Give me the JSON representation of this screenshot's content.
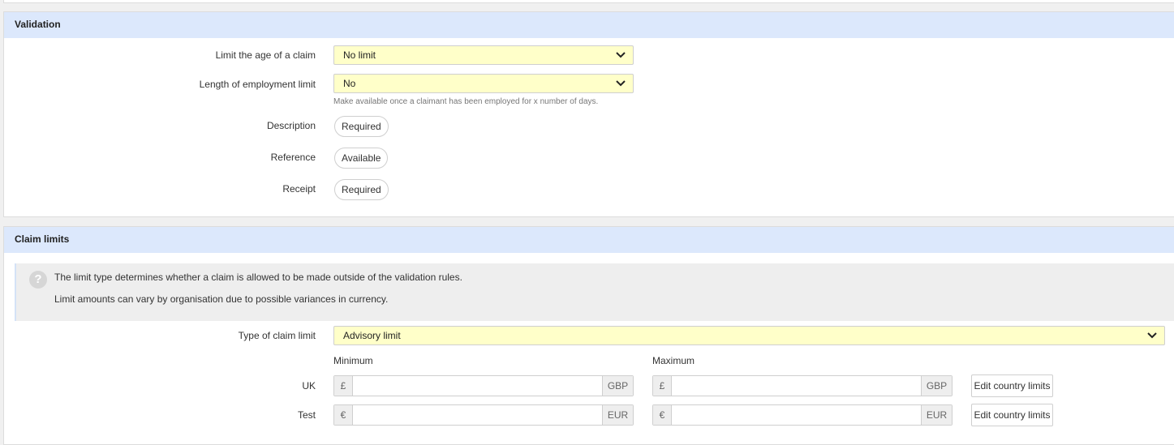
{
  "validation": {
    "title": "Validation",
    "age_limit": {
      "label": "Limit the age of a claim",
      "value": "No limit"
    },
    "employment_limit": {
      "label": "Length of employment limit",
      "value": "No",
      "hint": "Make available once a claimant has been employed for x number of days."
    },
    "description": {
      "label": "Description",
      "value": "Required"
    },
    "reference": {
      "label": "Reference",
      "value": "Available"
    },
    "receipt": {
      "label": "Receipt",
      "value": "Required"
    }
  },
  "claim_limits": {
    "title": "Claim limits",
    "info_icon": "question-icon",
    "info_lines": [
      "The limit type determines whether a claim is allowed to be made outside of the validation rules.",
      "Limit amounts can vary by organisation due to possible variances in currency."
    ],
    "type": {
      "label": "Type of claim limit",
      "value": "Advisory limit"
    },
    "minimum_label": "Minimum",
    "maximum_label": "Maximum",
    "rows": [
      {
        "name": "UK",
        "symbol": "£",
        "currency": "GBP",
        "min": "",
        "max": "",
        "button": "Edit country limits"
      },
      {
        "name": "Test",
        "symbol": "€",
        "currency": "EUR",
        "min": "",
        "max": "",
        "button": "Edit country limits"
      }
    ]
  },
  "colors": {
    "header_bg": "#dce8fc",
    "select_bg": "#ffffc9",
    "page_bg": "#f0f0f0"
  }
}
